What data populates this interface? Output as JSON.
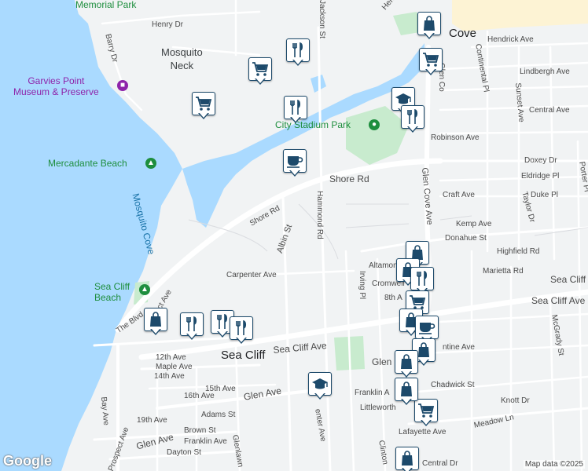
{
  "colors": {
    "water": "#aadaff",
    "land": "#f1f3f4",
    "park": "#c8ebce",
    "town": "#fdf3d4",
    "road": "#ffffff",
    "pin_border": "#1d4a6b",
    "poi_green": "#1e8e3e",
    "poi_purple": "#8e24aa"
  },
  "labels": {
    "memorial_park": "Memorial Park",
    "henry_dr": "Henry Dr",
    "barry_dr": "Barry Dr",
    "mosquito_neck": "Mosquito\nNeck",
    "garvies_line1": "Garvies Point",
    "garvies_line2": "Museum & Preserve",
    "mercadante": "Mercadante Beach",
    "mosquito_cove": "Mosquito Cove",
    "sea_cliff_beach_1": "Sea Cliff",
    "sea_cliff_beach_2": "Beach",
    "city_stadium_park": "City Stadium Park",
    "herb_hill": "Herb Hill Rd",
    "jackson_st": "Jackson St",
    "glen_cove": "Cove",
    "hendrick_ave": "Hendrick Ave",
    "continental_pl": "Continental Pl",
    "lindbergh_ave": "Lindbergh Ave",
    "sunset_ave": "Sunset Ave",
    "central_ave": "Central Ave",
    "glen_cove_ave_top": "Glen Co",
    "robinson_ave": "Robinson Ave",
    "doxey_dr": "Doxey Dr",
    "porter_pl": "Porter Pl",
    "eldridge_pl": "Eldridge Pl",
    "shore_rd_1": "Shore Rd",
    "shore_rd_2": "Shore Rd",
    "craft_ave": "Craft Ave",
    "duke_pl": "Duke Pl",
    "taylor_dr": "Taylor Dr",
    "glen_cove_ave": "Glen Cove Ave",
    "hammond_rd": "Hammond Rd",
    "albin_st": "Albin St",
    "kemp_ave": "Kemp Ave",
    "donahue_st": "Donahue St",
    "highfield_rd": "Highfield Rd",
    "altamont": "Altamont",
    "marietta_rd": "Marietta Rd",
    "carpenter_ave": "Carpenter Ave",
    "irving_pl": "Irving Pl",
    "cromwell": "Cromwell",
    "eighth_ave": "8th A",
    "sea_cliff_ave_right_1": "Sea Cliff",
    "sea_cliff_ave_right_2": "Sea Cliff Ave",
    "mcgrady_st": "McGrady St",
    "the_blvd": "The Blvd",
    "prospect_ave_top": "Prospect Ave",
    "sea_cliff_ave_left": "Sea Cliff Ave",
    "sea_cliff_town": "Sea Cliff",
    "twelfth_ave": "12th Ave",
    "maple_ave": "Maple Ave",
    "fourteenth_ave": "14th Ave",
    "fifteenth_ave": "15th Ave",
    "sixteenth_ave": "16th Ave",
    "glen_ave_1": "Glen Ave",
    "glen_ave_mid": "Glen",
    "valentine_ave": "ntine Ave",
    "franklin_ave_right": "Franklin A",
    "chadwick_st": "Chadwick St",
    "knott_dr": "Knott Dr",
    "littleworth": "Littleworth",
    "bay_ave": "Bay Ave",
    "adams_st": "Adams St",
    "nineteenth_ave": "19th Ave",
    "brown_st": "Brown St",
    "glen_ave_2": "Glen Ave",
    "franklin_ave_left": "Franklin Ave",
    "dayton_st": "Dayton St",
    "prospect_ave_bottom": "Prospect Ave",
    "glenlawn": "Glenlawn",
    "carpenter_ave_2": "enter Ave",
    "lafayette_ave": "Lafayette Ave",
    "clinton": "Clinton",
    "meadow_ln": "Meadow Ln",
    "central_dr": "Central Dr"
  },
  "pins": [
    {
      "icon": "shopping-bag-icon"
    },
    {
      "icon": "shopping-cart-icon"
    },
    {
      "icon": "restaurant-icon"
    },
    {
      "icon": "shopping-cart-icon"
    },
    {
      "icon": "shopping-cart-icon"
    },
    {
      "icon": "restaurant-icon"
    },
    {
      "icon": "school-icon"
    },
    {
      "icon": "restaurant-icon"
    },
    {
      "icon": "cafe-icon"
    },
    {
      "icon": "shopping-bag-icon"
    },
    {
      "icon": "shopping-bag-icon"
    },
    {
      "icon": "restaurant-icon"
    },
    {
      "icon": "shopping-cart-icon"
    },
    {
      "icon": "shopping-bag-icon"
    },
    {
      "icon": "cafe-icon"
    },
    {
      "icon": "shopping-bag-icon"
    },
    {
      "icon": "shopping-bag-icon"
    },
    {
      "icon": "restaurant-icon"
    },
    {
      "icon": "restaurant-icon"
    },
    {
      "icon": "restaurant-icon"
    },
    {
      "icon": "school-icon"
    },
    {
      "icon": "shopping-bag-icon"
    },
    {
      "icon": "shopping-cart-icon"
    },
    {
      "icon": "shopping-bag-icon"
    },
    {
      "icon": "shopping-bag-icon"
    }
  ],
  "footer": {
    "logo": "Google",
    "attribution": "Map data ©2025"
  }
}
